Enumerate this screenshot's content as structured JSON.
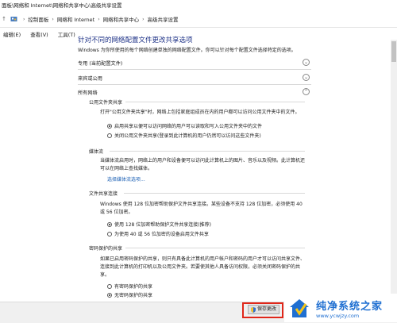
{
  "window": {
    "title": "面板\\网络和 Internet\\网络和共享中心\\高级共享设置"
  },
  "address": {
    "crumbs": [
      "控制面板",
      "网络和 Internet",
      "网络和共享中心",
      "高级共享设置"
    ]
  },
  "menu": {
    "items": [
      "编辑(E)",
      "查看(V)",
      "工具(T)"
    ]
  },
  "main": {
    "heading": "针对不同的网络配置文件更改共享选项",
    "intro": "Windows 为你所使用的每个网络创建单独的网络配置文件。你可以针对每个配置文件选择特定的选项。",
    "profiles": [
      {
        "label": "专用 (当前配置文件)",
        "chevron": "⌄"
      },
      {
        "label": "来宾或公用",
        "chevron": "⌄"
      },
      {
        "label": "所有网络",
        "chevron": "⌃"
      }
    ],
    "public_folder": {
      "title": "公用文件夹共享",
      "desc": "打开\"公用文件夹共享\"时，网络上包括家庭组成员在内的用户都可以访问公用文件夹中的文件。",
      "options": [
        {
          "label": "启用共享以便可以访问网络的用户可以读取和写入公用文件夹中的文件",
          "selected": true
        },
        {
          "label": "关闭公用文件夹共享(登录到此计算机的用户仍然可以访问这些文件夹)",
          "selected": false
        }
      ]
    },
    "media": {
      "title": "媒体流",
      "desc": "当媒体流启用时，网络上的用户和设备便可以访问此计算机上的图片、音乐以及视频。此计算机还可以在网络上查找媒体。",
      "link": "选择媒体流选项..."
    },
    "file_sharing": {
      "title": "文件共享连接",
      "desc": "Windows 使用 128 位加密帮助保护文件共享连接。某些设备不支持 128 位加密，必须使用 40 或 56 位加密。",
      "options": [
        {
          "label": "使用 128 位加密帮助保护文件共享连接(推荐)",
          "selected": true
        },
        {
          "label": "为使用 40 或 56 位加密的设备启用文件共享",
          "selected": false
        }
      ]
    },
    "password": {
      "title": "密码保护的共享",
      "desc": "如果已启用密码保护的共享，则只有具备此计算机的用户帐户和密码的用户才可以访问共享文件、连接到此计算机的打印机以及公用文件夹。若要使其他人具备访问权限，必须关闭密码保护的共享。",
      "options": [
        {
          "label": "有密码保护的共享",
          "selected": false
        },
        {
          "label": "无密码保护的共享",
          "selected": true
        }
      ]
    }
  },
  "footer": {
    "save_label": "保存更改"
  },
  "watermark": {
    "title": "纯净系统之家",
    "url": "www.ycwjzy.com"
  }
}
